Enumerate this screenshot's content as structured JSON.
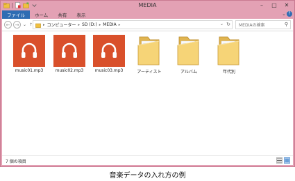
{
  "window": {
    "title": "MEDIA"
  },
  "ribbon": {
    "tabs": [
      {
        "label": "ファイル"
      },
      {
        "label": "ホーム"
      },
      {
        "label": "共有"
      },
      {
        "label": "表示"
      }
    ]
  },
  "address": {
    "segments": [
      "コンピューター",
      "SD (D:)",
      "MEDIA"
    ]
  },
  "search": {
    "placeholder": "MEDIAの検索"
  },
  "items": [
    {
      "label": "music01.mp3",
      "kind": "audio-file"
    },
    {
      "label": "music02.mp3",
      "kind": "audio-file"
    },
    {
      "label": "music03.mp3",
      "kind": "audio-file"
    },
    {
      "label": "アーティスト",
      "kind": "folder"
    },
    {
      "label": "アルバム",
      "kind": "folder"
    },
    {
      "label": "年代別",
      "kind": "folder"
    }
  ],
  "status": {
    "text": "7 個の項目"
  },
  "caption": "音楽データの入れ方の例",
  "colors": {
    "frame": "#e3a1b4",
    "file_tab": "#2f6db3",
    "audio_tile": "#d9502b",
    "folder": "#f3cf6a"
  }
}
